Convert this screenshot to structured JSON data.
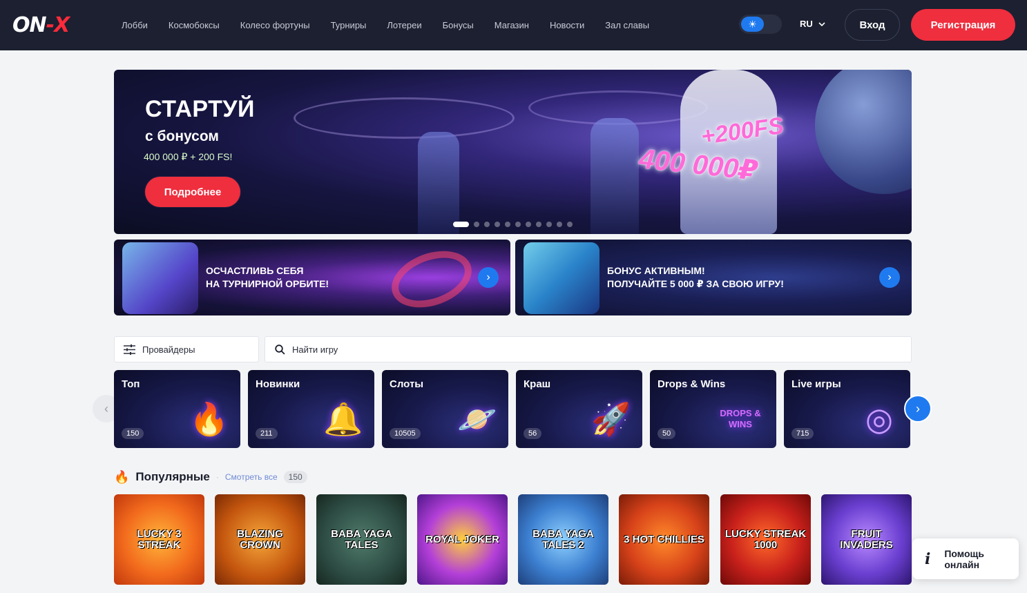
{
  "header": {
    "logo_left": "ON",
    "logo_right": "X",
    "nav": [
      "Лобби",
      "Космобоксы",
      "Колесо фортуны",
      "Турниры",
      "Лотереи",
      "Бонусы",
      "Магазин",
      "Новости",
      "Зал славы"
    ],
    "language": "RU",
    "login_label": "Вход",
    "register_label": "Регистрация"
  },
  "hero": {
    "title": "СТАРТУЙ",
    "subtitle": "с бонусом",
    "bonus_line": "400 000 ₽ + 200 FS!",
    "button_label": "Подробнее",
    "art_text_1": "400 000₽",
    "art_text_2": "+200FS",
    "slides_total": 11,
    "active_slide": 1
  },
  "promos": [
    {
      "line1": "Осчастливь себя",
      "line2": "на турнирной орбите!"
    },
    {
      "line1": "Бонус активным!",
      "line2": "Получайте 5 000 ₽ за свою игру!"
    }
  ],
  "filters": {
    "providers_label": "Провайдеры",
    "search_placeholder": "Найти игру"
  },
  "categories": [
    {
      "title": "Топ",
      "count": "150",
      "icon": "fire-icon",
      "glyph": "🔥"
    },
    {
      "title": "Новинки",
      "count": "211",
      "icon": "bell-icon",
      "glyph": "🔔"
    },
    {
      "title": "Слоты",
      "count": "10505",
      "icon": "planet-icon",
      "glyph": "🪐"
    },
    {
      "title": "Краш",
      "count": "56",
      "icon": "rocket-icon",
      "glyph": "🚀"
    },
    {
      "title": "Drops & Wins",
      "count": "50",
      "icon": "drops-wins-logo",
      "glyph": "DROPS & WINS"
    },
    {
      "title": "Live игры",
      "count": "715",
      "icon": "roulette-icon",
      "glyph": "◎"
    }
  ],
  "popular": {
    "title": "Популярные",
    "view_all": "Смотреть все",
    "count": "150",
    "games": [
      {
        "name": "Lucky 3 Streak",
        "bg": "#f26b1d"
      },
      {
        "name": "Blazing Crown",
        "bg": "#c4560e"
      },
      {
        "name": "Baba Yaga Tales",
        "bg": "#2d4c44"
      },
      {
        "name": "Royal Joker",
        "bg": "#7c2bb4"
      },
      {
        "name": "Baba Yaga Tales 2",
        "bg": "#3c7fd0"
      },
      {
        "name": "3 Hot Chillies",
        "bg": "#d8431a"
      },
      {
        "name": "Lucky Streak 1000",
        "bg": "#c8201b"
      },
      {
        "name": "Fruit Invaders",
        "bg": "#6a3fd0"
      }
    ]
  },
  "help": {
    "line1": "Помощь",
    "line2": "онлайн"
  },
  "colors": {
    "accent_red": "#ef2e3e",
    "accent_blue": "#1f7af0",
    "header_bg": "#1c2030"
  }
}
